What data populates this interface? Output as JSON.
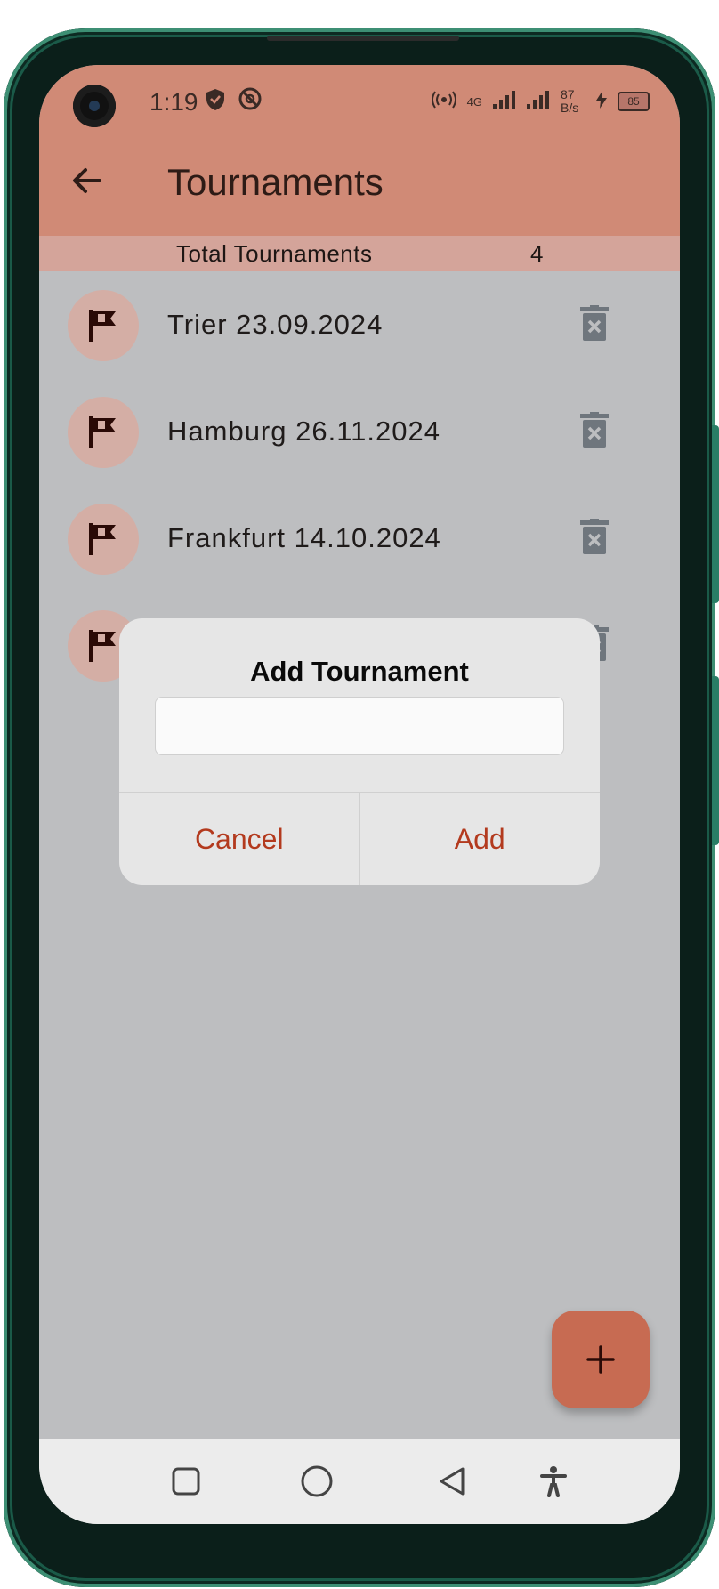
{
  "status_bar": {
    "time": "1:19",
    "network_speed": "87 B/s",
    "network_type": "4G",
    "battery": "85",
    "left_icons": [
      "shield-icon",
      "no-disturb-icon"
    ],
    "right_icons": [
      "hotspot-icon",
      "signal-icon",
      "signal-icon",
      "charging-icon",
      "battery-icon"
    ]
  },
  "app_bar": {
    "title": "Tournaments",
    "back_icon": "arrow-left-icon",
    "color": "#d08a76"
  },
  "summary": {
    "label": "Total Tournaments",
    "count": "4"
  },
  "tournaments": [
    {
      "name": "Trier 23.09.2024",
      "icon": "flag-icon",
      "action_icon": "trash-icon"
    },
    {
      "name": "Hamburg 26.11.2024",
      "icon": "flag-icon",
      "action_icon": "trash-icon"
    },
    {
      "name": "Frankfurt 14.10.2024",
      "icon": "flag-icon",
      "action_icon": "trash-icon"
    },
    {
      "name": "",
      "icon": "flag-icon",
      "action_icon": "trash-icon"
    }
  ],
  "dialog": {
    "title": "Add Tournament",
    "input_value": "",
    "cancel_label": "Cancel",
    "add_label": "Add",
    "accent_color": "#b33a1e"
  },
  "fab": {
    "icon": "plus-icon",
    "color": "#c76b52"
  },
  "nav_bar": {
    "buttons": [
      "recents-icon",
      "home-icon",
      "back-icon",
      "accessibility-icon"
    ]
  }
}
